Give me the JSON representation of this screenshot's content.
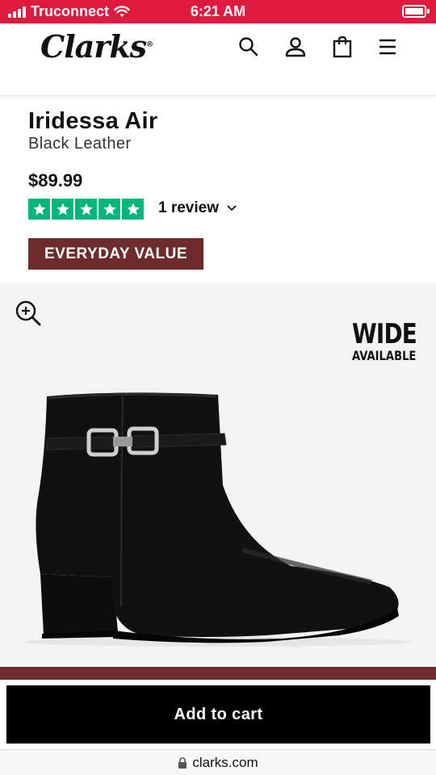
{
  "status_bar": {
    "carrier": "Truconnect",
    "time": "6:21 AM"
  },
  "header": {
    "logo": "Clarks",
    "icons": [
      "search-icon",
      "account-icon",
      "bag-icon",
      "menu-icon"
    ]
  },
  "product": {
    "name": "Iridessa Air",
    "variant": "Black Leather",
    "price": "$89.99",
    "rating_stars": 5,
    "reviews_label": "1 review",
    "badge": "EVERYDAY VALUE"
  },
  "image": {
    "wide_line1": "WIDE",
    "wide_line2": "AVAILABLE"
  },
  "cart": {
    "button_label": "Add to cart"
  },
  "browser": {
    "url": "clarks.com"
  },
  "colors": {
    "status_red": "#e0193f",
    "trustpilot_green": "#00b67a",
    "maroon": "#6e2b2b"
  }
}
